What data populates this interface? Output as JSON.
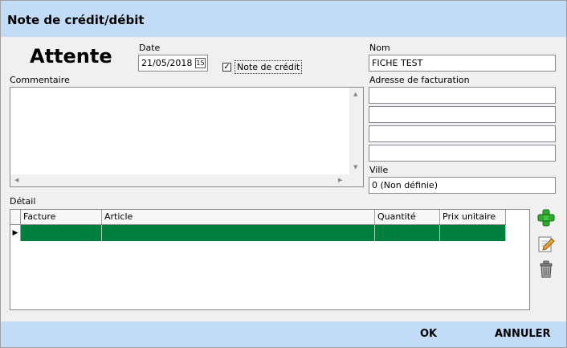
{
  "window": {
    "title": "Note de crédit/débit"
  },
  "status_label": "Attente",
  "date": {
    "label": "Date",
    "value": "21/05/2018",
    "calendar_glyph": "15"
  },
  "credit_note": {
    "label": "Note de crédit",
    "checked": true,
    "check_glyph": "✓"
  },
  "comment": {
    "label": "Commentaire",
    "value": ""
  },
  "name": {
    "label": "Nom",
    "value": "FICHE TEST"
  },
  "billing_address": {
    "label": "Adresse de facturation",
    "lines": [
      "",
      "",
      "",
      ""
    ]
  },
  "city": {
    "label": "Ville",
    "value": "0 (Non définie)"
  },
  "detail": {
    "label": "Détail",
    "columns": [
      "Facture",
      "Article",
      "Quantité",
      "Prix unitaire"
    ],
    "current_row_glyph": "▶",
    "rows": [
      {
        "facture": "",
        "article": "",
        "quantite": "",
        "prix_unitaire": ""
      }
    ],
    "selected_row_color": "#007f3f"
  },
  "side_actions": {
    "add_icon": "plus-icon",
    "edit_icon": "edit-icon",
    "delete_icon": "trash-icon"
  },
  "footer": {
    "ok_label": "OK",
    "cancel_label": "ANNULER"
  }
}
